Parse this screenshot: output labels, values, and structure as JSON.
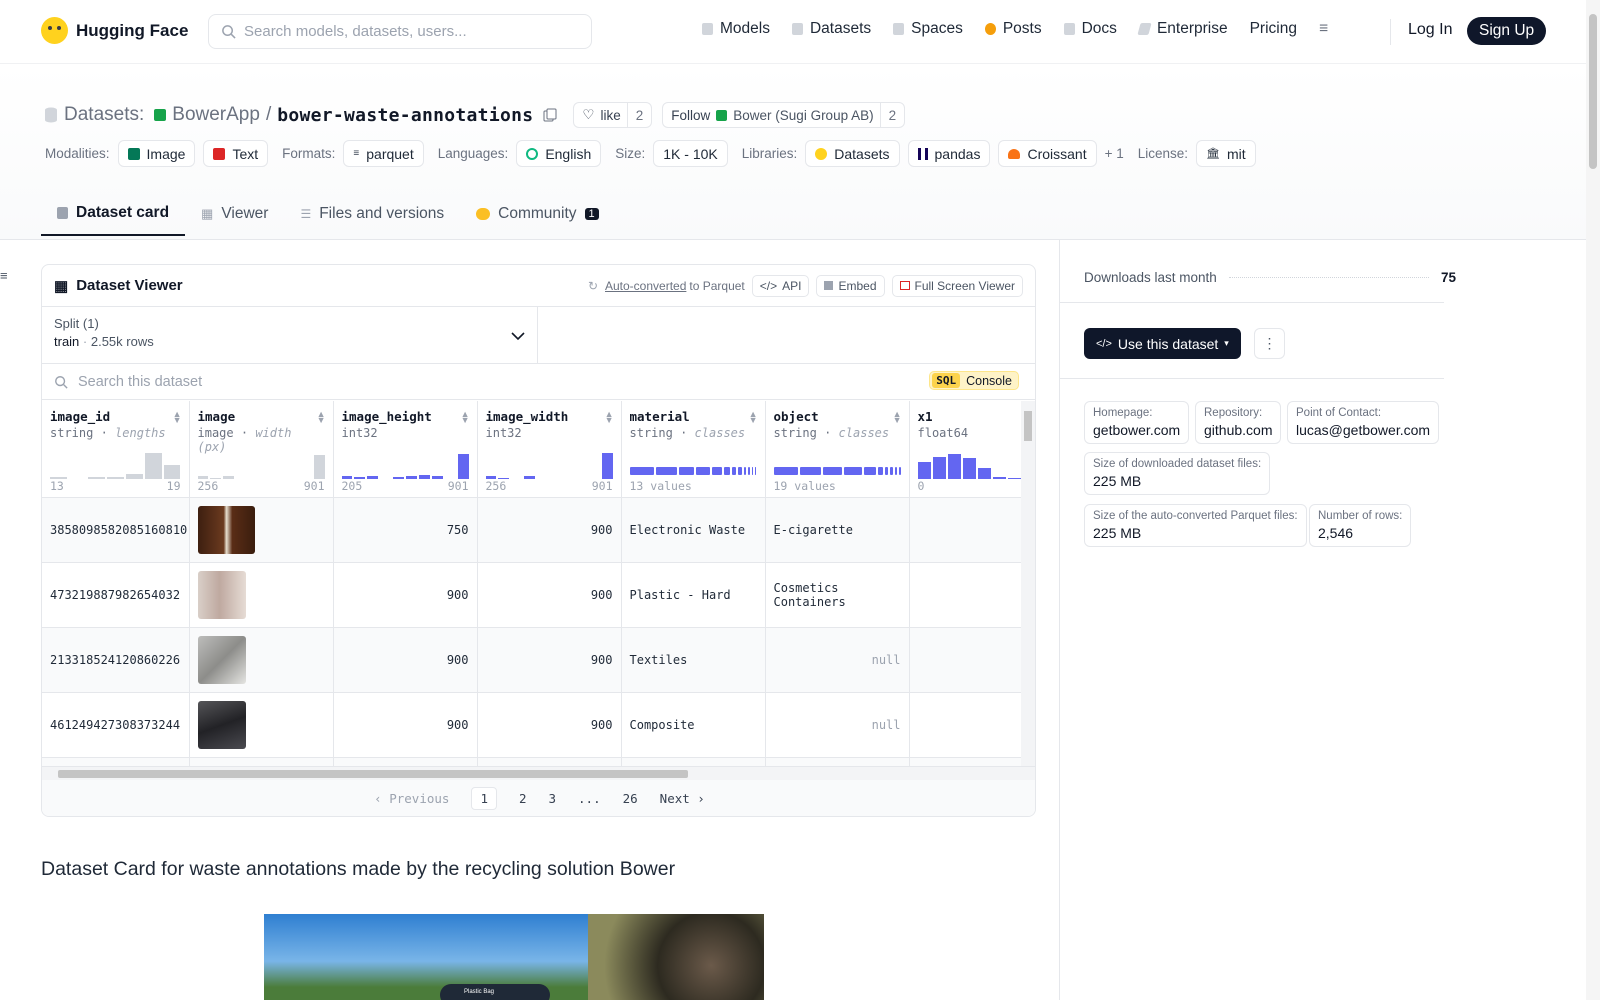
{
  "nav": {
    "brand": "Hugging Face",
    "search_placeholder": "Search models, datasets, users...",
    "links": [
      "Models",
      "Datasets",
      "Spaces",
      "Posts",
      "Docs",
      "Enterprise",
      "Pricing"
    ],
    "login": "Log In",
    "signup": "Sign Up"
  },
  "header": {
    "section": "Datasets:",
    "org": "BowerApp",
    "slash": "/",
    "repo": "bower-waste-annotations",
    "like_label": "like",
    "like_count": "2",
    "follow_label": "Follow",
    "follow_org": "Bower (Sugi Group AB)",
    "follow_count": "2",
    "tags": {
      "modalities_label": "Modalities:",
      "modalities": [
        "Image",
        "Text"
      ],
      "formats_label": "Formats:",
      "format": "parquet",
      "languages_label": "Languages:",
      "language": "English",
      "size_label": "Size:",
      "size": "1K - 10K",
      "libraries_label": "Libraries:",
      "libraries": [
        "Datasets",
        "pandas",
        "Croissant"
      ],
      "more": "+ 1",
      "license_label": "License:",
      "license": "mit"
    },
    "tabs": [
      "Dataset card",
      "Viewer",
      "Files and versions",
      "Community"
    ],
    "community_count": "1"
  },
  "viewer": {
    "title": "Dataset Viewer",
    "auto_converted": "Auto-converted",
    "to_parquet": "to Parquet",
    "api": "API",
    "embed": "Embed",
    "full_screen": "Full Screen Viewer",
    "split_label": "Split (1)",
    "split_name": "train",
    "split_rows": "2.55k rows",
    "search_placeholder": "Search this dataset",
    "sql": "SQL",
    "console": "Console",
    "columns": [
      {
        "name": "image_id",
        "type": "string",
        "stat": "lengths",
        "min": "13",
        "max": "19"
      },
      {
        "name": "image",
        "type": "image",
        "stat": "width (px)",
        "min": "256",
        "max": "901"
      },
      {
        "name": "image_height",
        "type": "int32",
        "stat": "",
        "min": "205",
        "max": "901"
      },
      {
        "name": "image_width",
        "type": "int32",
        "stat": "",
        "min": "256",
        "max": "901"
      },
      {
        "name": "material",
        "type": "string",
        "stat": "classes",
        "min": "13 values",
        "max": ""
      },
      {
        "name": "object",
        "type": "string",
        "stat": "classes",
        "min": "19 values",
        "max": ""
      },
      {
        "name": "x1",
        "type": "float64",
        "stat": "",
        "min": "0",
        "max": ""
      }
    ],
    "rows": [
      {
        "image_id": "3858098582085160810",
        "image_height": "750",
        "image_width": "900",
        "material": "Electronic Waste",
        "object": "E-cigarette",
        "thumb_color": "#4a2a18"
      },
      {
        "image_id": "473219887982654032",
        "image_height": "900",
        "image_width": "900",
        "material": "Plastic - Hard",
        "object": "Cosmetics Containers",
        "thumb_color": "#c9bdb6"
      },
      {
        "image_id": "213318524120860226",
        "image_height": "900",
        "image_width": "900",
        "material": "Textiles",
        "object": "null",
        "thumb_color": "#9a9a98"
      },
      {
        "image_id": "461249427308373244",
        "image_height": "900",
        "image_width": "900",
        "material": "Composite",
        "object": "null",
        "thumb_color": "#2f2f33"
      }
    ],
    "pager": {
      "previous": "Previous",
      "pages": [
        "1",
        "2",
        "3",
        "...",
        "26"
      ],
      "next": "Next"
    }
  },
  "card": {
    "title": "Dataset Card for waste annotations made by the recycling solution Bower",
    "hero_chip": "Plastic Bag"
  },
  "sidebar": {
    "downloads_label": "Downloads last month",
    "downloads": "75",
    "use_dataset": "Use this dataset",
    "homepage_label": "Homepage:",
    "homepage": "getbower.com",
    "repository_label": "Repository:",
    "repository": "github.com",
    "contact_label": "Point of Contact:",
    "contact": "lucas@getbower.com",
    "downloaded_size_label": "Size of downloaded dataset files:",
    "downloaded_size": "225 MB",
    "parquet_size_label": "Size of the auto-converted Parquet files:",
    "parquet_size": "225 MB",
    "rows_label": "Number of rows:",
    "rows": "2,546"
  }
}
